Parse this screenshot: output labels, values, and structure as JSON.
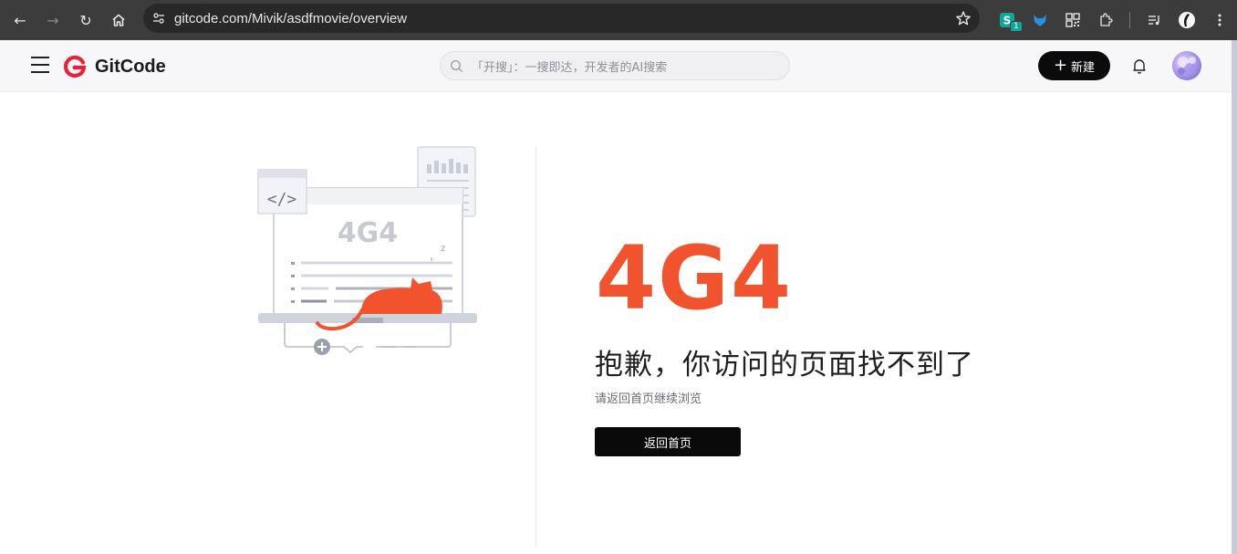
{
  "browser": {
    "url": "gitcode.com/Mivik/asdfmovie/overview",
    "back_icon": "←",
    "forward_icon": "→",
    "reload_icon": "↻",
    "extension_badge": "1"
  },
  "header": {
    "brand": "GitCode",
    "search_placeholder": "「开搜」：一搜即达，开发者的AI搜索",
    "new_button_label": "新建"
  },
  "error": {
    "code_text": "4G4",
    "illustration_code": "4G4",
    "illustration_tag": "</>",
    "illustration_sleep": "z",
    "title": "抱歉，你访问的页面找不到了",
    "subtitle": "请返回首页继续浏览",
    "home_button_label": "返回首页"
  },
  "colors": {
    "accent": "#f0532d",
    "chrome_bg": "#3c3c3c",
    "header_bg": "#f7f7f9",
    "button_bg": "#0a0a0a",
    "logo_red": "#e5243b"
  }
}
